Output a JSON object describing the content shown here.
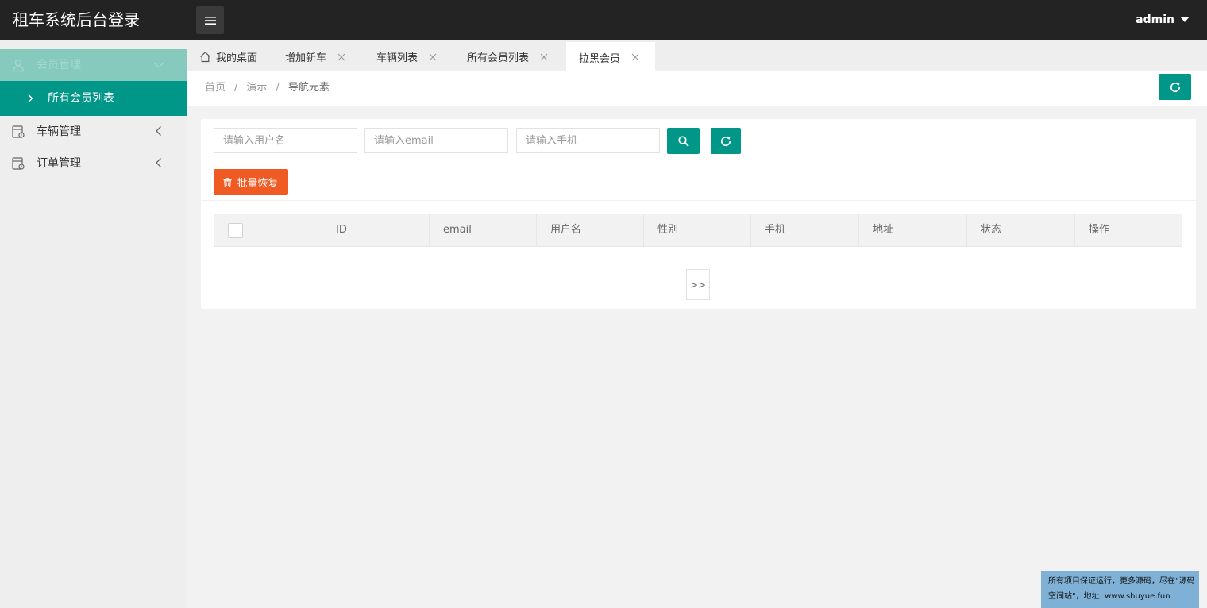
{
  "header": {
    "app_title": "租车系统后台登录",
    "user_name": "admin"
  },
  "sidebar": {
    "groups": [
      {
        "label": "会员管理",
        "expanded": true,
        "children": [
          {
            "label": "所有会员列表",
            "active": true
          }
        ]
      },
      {
        "label": "车辆管理",
        "expanded": false
      },
      {
        "label": "订单管理",
        "expanded": false
      }
    ]
  },
  "tabs": [
    {
      "label": "我的桌面",
      "closable": false,
      "active": false
    },
    {
      "label": "增加新车",
      "closable": true,
      "active": false
    },
    {
      "label": "车辆列表",
      "closable": true,
      "active": false
    },
    {
      "label": "所有会员列表",
      "closable": true,
      "active": false
    },
    {
      "label": "拉黑会员",
      "closable": true,
      "active": true
    }
  ],
  "breadcrumb": {
    "items": [
      "首页",
      "演示",
      "导航元素"
    ],
    "separator": "/"
  },
  "search": {
    "username_placeholder": "请输入用户名",
    "email_placeholder": "请输入email",
    "phone_placeholder": "请输入手机"
  },
  "actions": {
    "batch_restore_label": "批量恢复"
  },
  "table": {
    "columns": [
      "ID",
      "email",
      "用户名",
      "性别",
      "手机",
      "地址",
      "状态",
      "操作"
    ],
    "rows": []
  },
  "pagination": {
    "next_label": ">>"
  },
  "watermark": {
    "line1": "所有项目保证运行，更多源码，尽在\"源码",
    "line2": "空间站\"，地址: www.shuyue.fun"
  },
  "colors": {
    "header_bg": "#232323",
    "primary": "#009688",
    "danger": "#f05a23",
    "sidebar_bg": "#eeeeee"
  },
  "icons": [
    "menu-icon",
    "caret-down-icon",
    "user-icon",
    "chevron-down-icon",
    "chevron-right-icon",
    "chevron-left-icon",
    "car-icon",
    "order-icon",
    "home-icon",
    "close-icon",
    "refresh-icon",
    "search-icon",
    "trash-icon"
  ]
}
